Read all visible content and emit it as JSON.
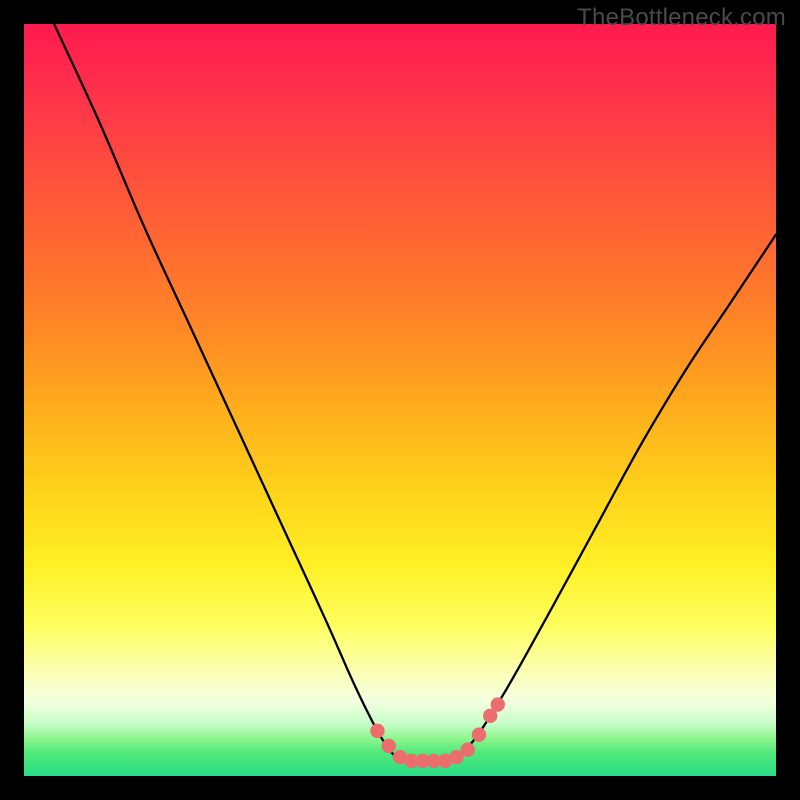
{
  "watermark": "TheBottleneck.com",
  "chart_data": {
    "type": "line",
    "title": "",
    "xlabel": "",
    "ylabel": "",
    "xlim": [
      0,
      100
    ],
    "ylim": [
      0,
      100
    ],
    "series": [
      {
        "name": "curve",
        "x": [
          4,
          10,
          16,
          22,
          28,
          34,
          40,
          44,
          47,
          49,
          50.5,
          52,
          55,
          58,
          60,
          62,
          65,
          70,
          76,
          82,
          88,
          94,
          100
        ],
        "values": [
          100,
          87,
          73,
          60,
          47,
          34,
          21,
          12,
          6,
          3,
          2,
          2,
          2,
          3,
          5,
          8,
          13,
          22,
          33,
          44,
          54,
          63,
          72
        ]
      }
    ],
    "markers": [
      {
        "x": 47.0,
        "y": 6.0
      },
      {
        "x": 48.5,
        "y": 4.0
      },
      {
        "x": 50.0,
        "y": 2.5
      },
      {
        "x": 51.5,
        "y": 2.0
      },
      {
        "x": 53.0,
        "y": 2.0
      },
      {
        "x": 54.5,
        "y": 2.0
      },
      {
        "x": 56.0,
        "y": 2.0
      },
      {
        "x": 57.5,
        "y": 2.5
      },
      {
        "x": 59.0,
        "y": 3.5
      },
      {
        "x": 60.5,
        "y": 5.5
      },
      {
        "x": 62.0,
        "y": 8.0
      },
      {
        "x": 63.0,
        "y": 9.5
      }
    ],
    "marker_color": "#ec6d6d",
    "curve_color": "#000000"
  }
}
